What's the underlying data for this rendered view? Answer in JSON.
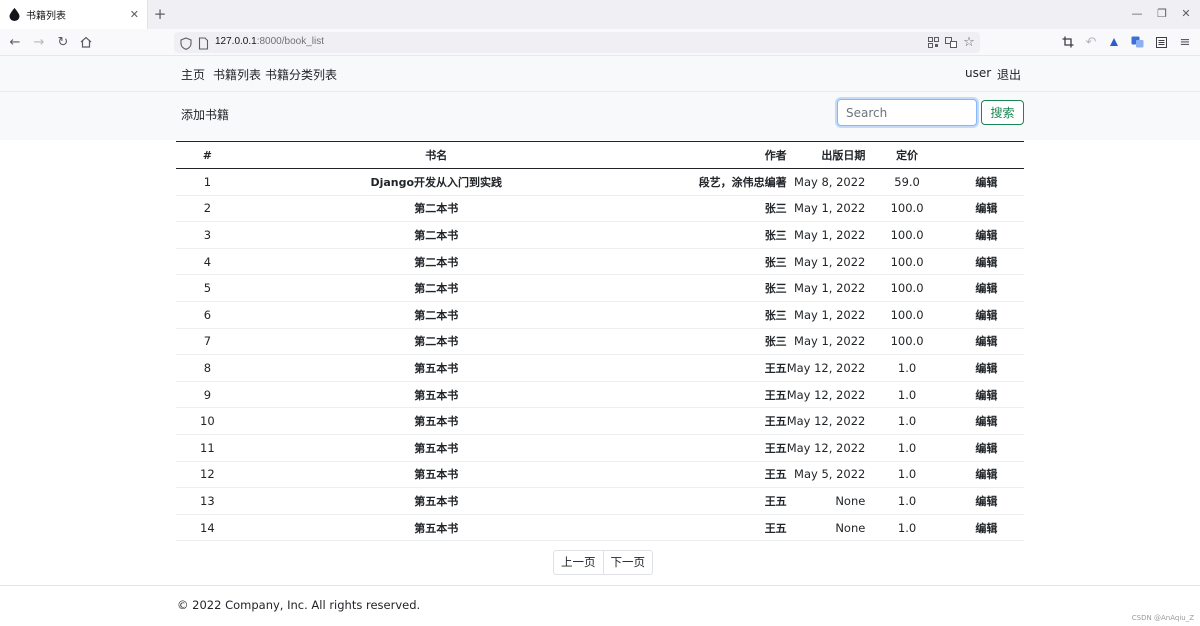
{
  "browser": {
    "tab_title": "书籍列表",
    "url_host": "127.0.0.1",
    "url_rest": ":8000/book_list",
    "tab_close": "✕",
    "new_tab": "+"
  },
  "nav": {
    "home": "主页",
    "book_list": "书籍列表",
    "category_list": "书籍分类列表",
    "user": "user",
    "logout": "退出"
  },
  "toolbar": {
    "add_book": "添加书籍",
    "search_placeholder": "Search",
    "search_button": "搜索"
  },
  "table": {
    "headers": [
      "#",
      "书名",
      "作者",
      "出版日期",
      "定价",
      ""
    ],
    "rows": [
      {
        "id": "1",
        "title": "Django开发从入门到实践",
        "author": "段艺，涂伟忠编著",
        "date": "May 8, 2022",
        "price": "59.0",
        "action": "编辑"
      },
      {
        "id": "2",
        "title": "第二本书",
        "author": "张三",
        "date": "May 1, 2022",
        "price": "100.0",
        "action": "编辑"
      },
      {
        "id": "3",
        "title": "第二本书",
        "author": "张三",
        "date": "May 1, 2022",
        "price": "100.0",
        "action": "编辑"
      },
      {
        "id": "4",
        "title": "第二本书",
        "author": "张三",
        "date": "May 1, 2022",
        "price": "100.0",
        "action": "编辑"
      },
      {
        "id": "5",
        "title": "第二本书",
        "author": "张三",
        "date": "May 1, 2022",
        "price": "100.0",
        "action": "编辑"
      },
      {
        "id": "6",
        "title": "第二本书",
        "author": "张三",
        "date": "May 1, 2022",
        "price": "100.0",
        "action": "编辑"
      },
      {
        "id": "7",
        "title": "第二本书",
        "author": "张三",
        "date": "May 1, 2022",
        "price": "100.0",
        "action": "编辑"
      },
      {
        "id": "8",
        "title": "第五本书",
        "author": "王五",
        "date": "May 12, 2022",
        "price": "1.0",
        "action": "编辑"
      },
      {
        "id": "9",
        "title": "第五本书",
        "author": "王五",
        "date": "May 12, 2022",
        "price": "1.0",
        "action": "编辑"
      },
      {
        "id": "10",
        "title": "第五本书",
        "author": "王五",
        "date": "May 12, 2022",
        "price": "1.0",
        "action": "编辑"
      },
      {
        "id": "11",
        "title": "第五本书",
        "author": "王五",
        "date": "May 12, 2022",
        "price": "1.0",
        "action": "编辑"
      },
      {
        "id": "12",
        "title": "第五本书",
        "author": "王五",
        "date": "May 5, 2022",
        "price": "1.0",
        "action": "编辑"
      },
      {
        "id": "13",
        "title": "第五本书",
        "author": "王五",
        "date": "None",
        "price": "1.0",
        "action": "编辑"
      },
      {
        "id": "14",
        "title": "第五本书",
        "author": "王五",
        "date": "None",
        "price": "1.0",
        "action": "编辑"
      }
    ]
  },
  "pagination": {
    "prev": "上一页",
    "next": "下一页"
  },
  "footer": {
    "copyright": "© 2022 Company, Inc. All rights reserved.",
    "watermark": "CSDN @AnAqiu_Z"
  },
  "colors": {
    "accent_green": "#198754",
    "focus_blue": "#86b7fe",
    "nav_bg": "#f8f9fa"
  }
}
